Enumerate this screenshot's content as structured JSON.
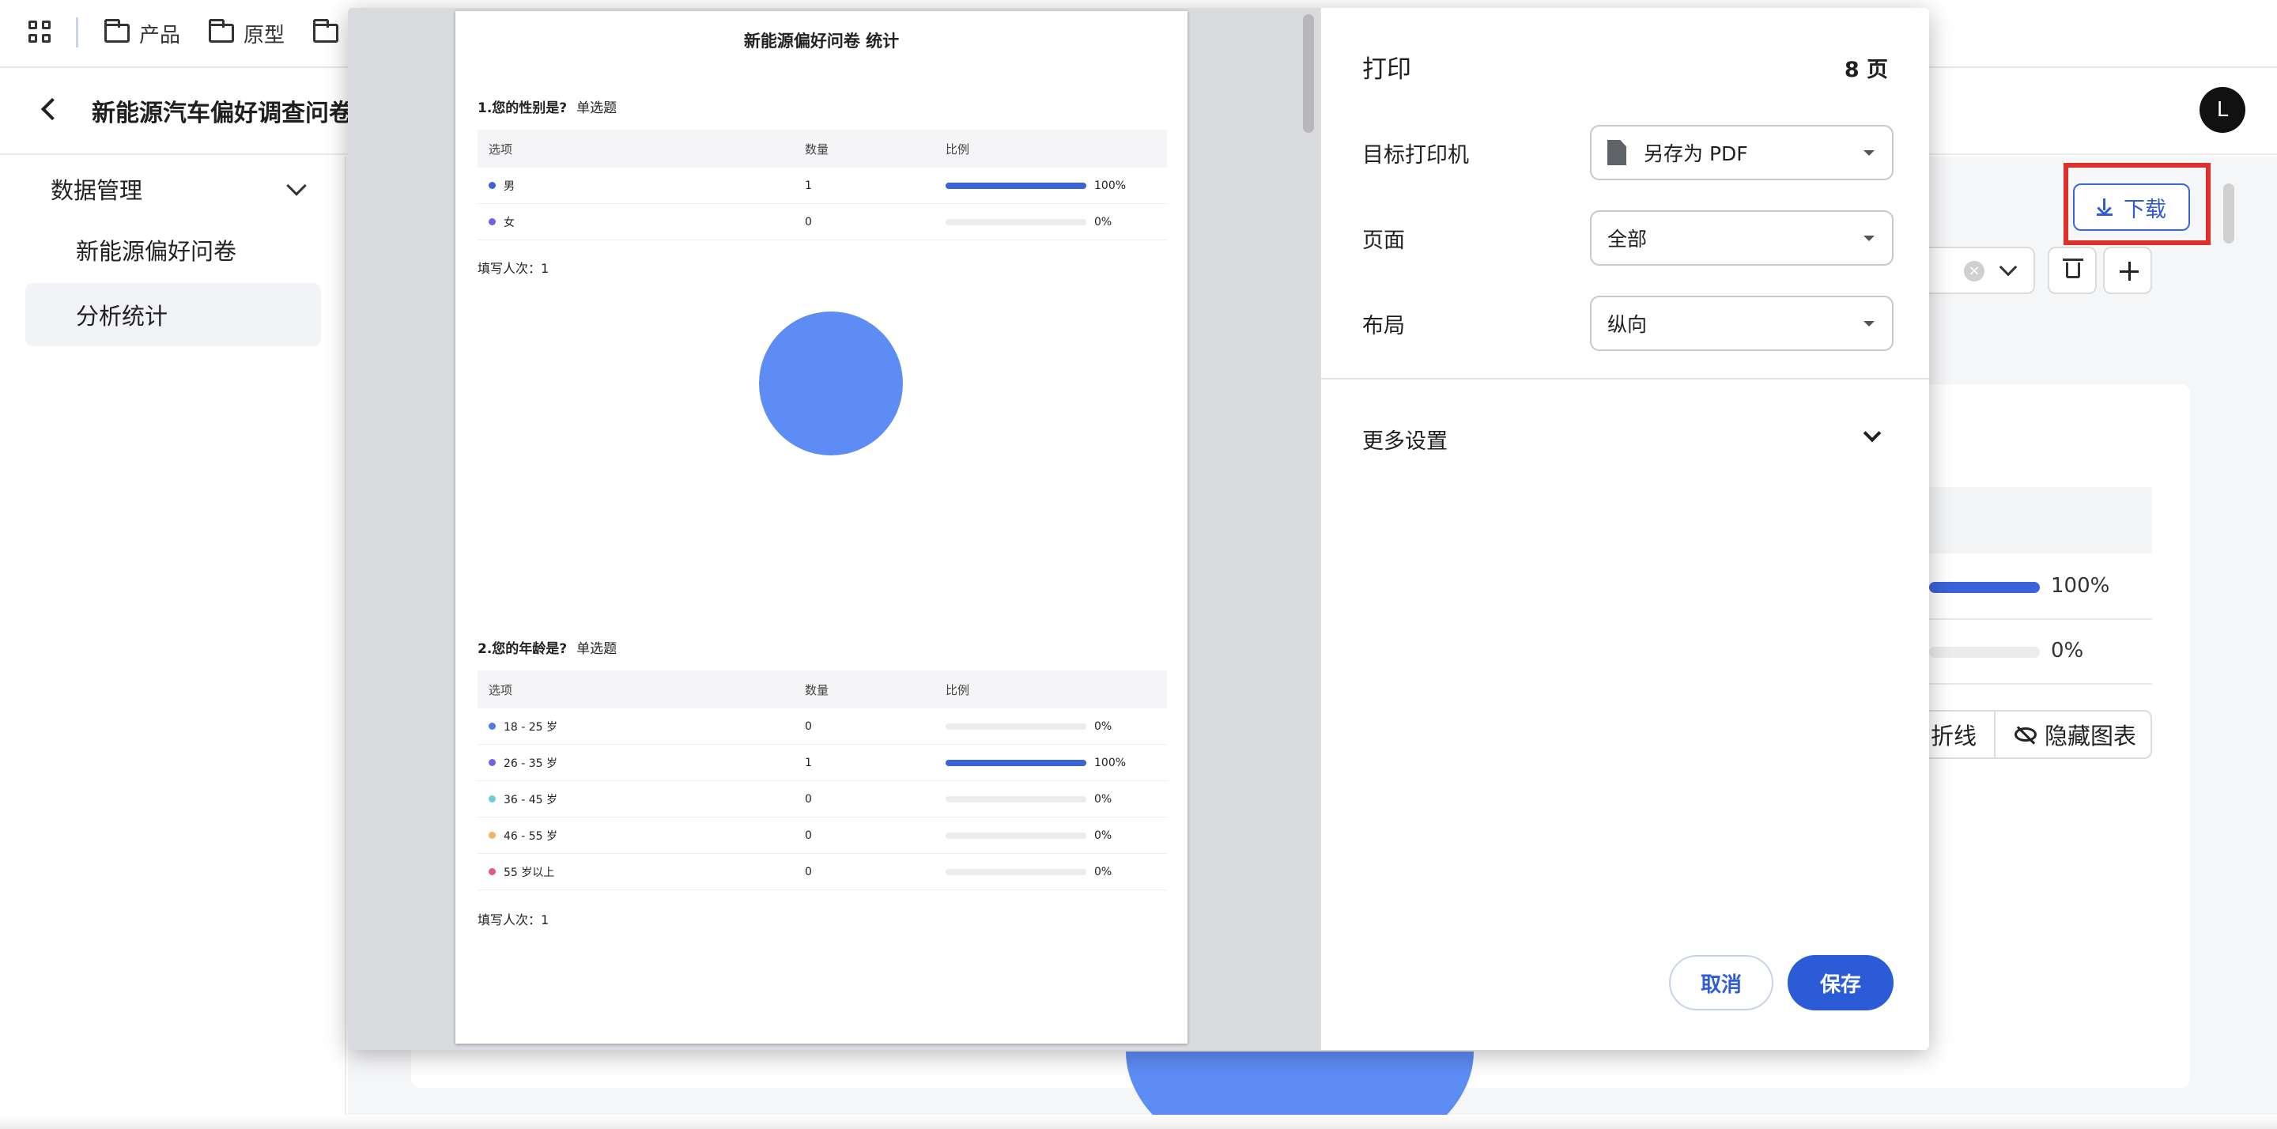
{
  "bookmarks": {
    "items": [
      {
        "label": "产品"
      },
      {
        "label": "原型"
      },
      {
        "label": ""
      }
    ]
  },
  "header": {
    "title": "新能源汽车偏好调查问卷",
    "avatar_initial": "L"
  },
  "sidebar": {
    "group_label": "数据管理",
    "items": [
      {
        "label": "新能源偏好问卷",
        "active": false
      },
      {
        "label": "分析统计",
        "active": true
      }
    ]
  },
  "main": {
    "download_label": "下载",
    "bg_percent_1": "100%",
    "bg_percent_2": "0%",
    "btn_line_label": "折线",
    "btn_hide_chart_label": "隐藏图表"
  },
  "print_dialog": {
    "title": "打印",
    "page_count": "8 页",
    "printer_label": "目标打印机",
    "printer_value": "另存为 PDF",
    "pages_label": "页面",
    "pages_value": "全部",
    "layout_label": "布局",
    "layout_value": "纵向",
    "more_settings": "更多设置",
    "cancel": "取消",
    "save": "保存"
  },
  "preview": {
    "title": "新能源偏好问卷 统计",
    "headers": {
      "option": "选项",
      "count": "数量",
      "ratio": "比例"
    },
    "q1": {
      "title": "1.您的性别是?",
      "type": "单选题",
      "fill_count": "填写人次：1",
      "rows": [
        {
          "label": "男",
          "count": "1",
          "percent": "100%",
          "fraction": 1.0,
          "color": "#3a62d9"
        },
        {
          "label": "女",
          "count": "0",
          "percent": "0%",
          "fraction": 0.0,
          "color": "#7b5ce6"
        }
      ]
    },
    "q2": {
      "title": "2.您的年龄是?",
      "type": "单选题",
      "fill_count": "填写人次：1",
      "rows": [
        {
          "label": "18 - 25 岁",
          "count": "0",
          "percent": "0%",
          "fraction": 0.0,
          "color": "#4d7ee8"
        },
        {
          "label": "26 - 35 岁",
          "count": "1",
          "percent": "100%",
          "fraction": 1.0,
          "color": "#7b5ce6"
        },
        {
          "label": "36 - 45 岁",
          "count": "0",
          "percent": "0%",
          "fraction": 0.0,
          "color": "#6ccfd6"
        },
        {
          "label": "46 - 55 岁",
          "count": "0",
          "percent": "0%",
          "fraction": 0.0,
          "color": "#f3b469"
        },
        {
          "label": "55 岁以上",
          "count": "0",
          "percent": "0%",
          "fraction": 0.0,
          "color": "#e35b7e"
        }
      ]
    }
  }
}
